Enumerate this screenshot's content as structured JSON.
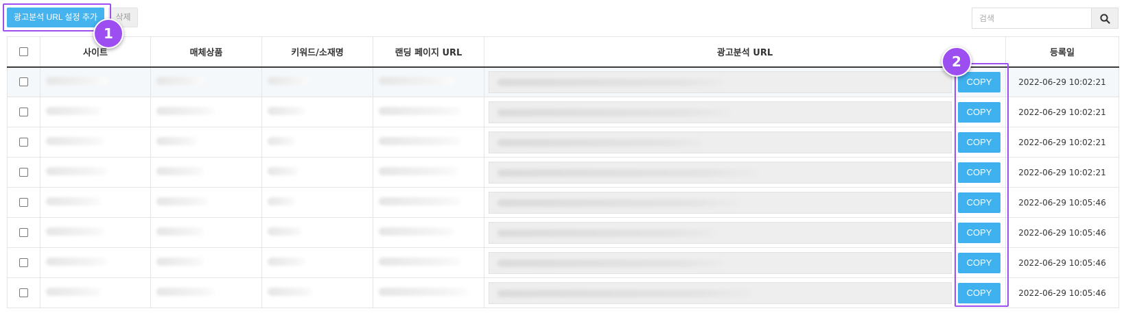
{
  "toolbar": {
    "add_label": "광고분석 URL 설정 추가",
    "delete_label": "삭제",
    "search_placeholder": "검색"
  },
  "table": {
    "headers": {
      "site": "사이트",
      "media_product": "매체상품",
      "keyword": "키워드/소재명",
      "landing_url": "랜딩 페이지 URL",
      "analysis_url": "광고분석 URL",
      "registered": "등록일"
    },
    "copy_label": "COPY",
    "rows": [
      {
        "date": "2022-06-29 10:02:21"
      },
      {
        "date": "2022-06-29 10:02:21"
      },
      {
        "date": "2022-06-29 10:02:21"
      },
      {
        "date": "2022-06-29 10:02:21"
      },
      {
        "date": "2022-06-29 10:05:46"
      },
      {
        "date": "2022-06-29 10:05:46"
      },
      {
        "date": "2022-06-29 10:05:46"
      },
      {
        "date": "2022-06-29 10:05:46"
      }
    ]
  },
  "annotations": {
    "badge1": "1",
    "badge2": "2",
    "highlight_color": "#9d4ef0"
  },
  "colors": {
    "accent": "#45b3ee",
    "copy_button": "#3fb1ef"
  }
}
